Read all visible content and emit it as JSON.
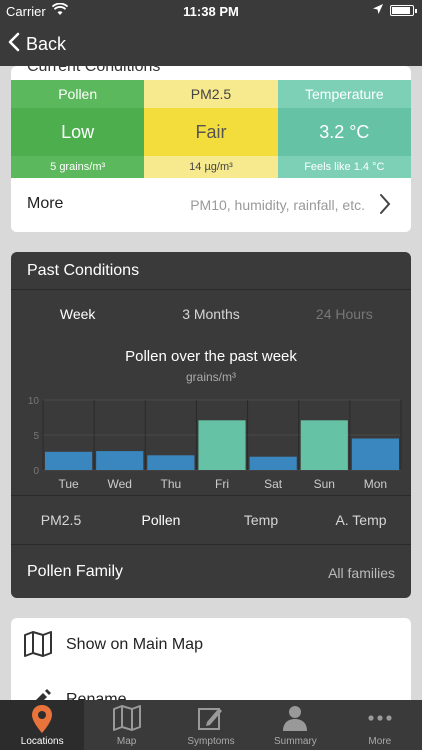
{
  "status": {
    "carrier": "Carrier",
    "time": "11:38 PM"
  },
  "nav": {
    "back_label": "Back"
  },
  "current": {
    "partial_title": "Current Conditions",
    "metrics": [
      {
        "header": "Pollen",
        "value": "Low",
        "footer": "5 grains/m³"
      },
      {
        "header": "PM2.5",
        "value": "Fair",
        "footer": "14 µg/m³"
      },
      {
        "header": "Temperature",
        "value": "3.2 °C",
        "footer": "Feels like 1.4 °C"
      }
    ],
    "more": {
      "label": "More",
      "description": "PM10, humidity, rainfall, etc."
    }
  },
  "past": {
    "title": "Past Conditions",
    "ranges": [
      "Week",
      "3 Months",
      "24 Hours"
    ],
    "metric_tabs": [
      "PM2.5",
      "Pollen",
      "Temp",
      "A. Temp"
    ],
    "family": {
      "label": "Pollen Family",
      "value": "All families"
    }
  },
  "chart_data": {
    "type": "bar",
    "title": "Pollen over the past week",
    "ylabel": "grains/m³",
    "categories": [
      "Tue",
      "Wed",
      "Thu",
      "Fri",
      "Sat",
      "Sun",
      "Mon"
    ],
    "values": [
      2.6,
      2.7,
      2.1,
      7.1,
      1.9,
      7.1,
      4.5
    ],
    "colors": [
      "#3a87c0",
      "#3a87c0",
      "#3a87c0",
      "#66c2a5",
      "#3a87c0",
      "#66c2a5",
      "#3a87c0"
    ],
    "ylim": [
      0,
      10
    ],
    "yticks": [
      "10",
      "5",
      "0"
    ],
    "grid": true
  },
  "actions": [
    {
      "label": "Show on Main Map",
      "icon": "map-icon"
    },
    {
      "label": "Rename",
      "icon": "pencil-icon"
    }
  ],
  "tabbar": [
    {
      "label": "Locations",
      "icon": "location-pin-icon",
      "active": true
    },
    {
      "label": "Map",
      "icon": "map-icon"
    },
    {
      "label": "Symptoms",
      "icon": "edit-square-icon"
    },
    {
      "label": "Summary",
      "icon": "person-icon"
    },
    {
      "label": "More",
      "icon": "more-dots-icon"
    }
  ],
  "colors": {
    "bar_dark": "#2c2c2c",
    "accent_orange": "#e8743b",
    "pollen_green": "#4cae4c",
    "pm_yellow": "#f2dd3c",
    "temp_teal": "#66c2a5",
    "bar_blue": "#3a87c0"
  }
}
